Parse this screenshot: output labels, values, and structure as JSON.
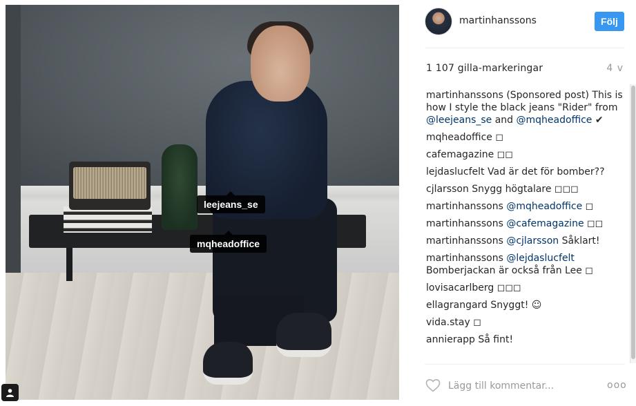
{
  "post": {
    "tags": [
      "leejeans_se",
      "mqheadoffice"
    ]
  },
  "header": {
    "username": "martinhanssons",
    "follow_label": "Följ"
  },
  "likes_text": "1 107 gilla-markeringar",
  "timestamp": "4 v",
  "comments": [
    {
      "user": "martinhanssons",
      "parts": [
        {
          "t": "text",
          "v": " (Sponsored post) This is how I style the black jeans \"Rider\" from "
        },
        {
          "t": "mention",
          "v": "@leejeans_se"
        },
        {
          "t": "text",
          "v": " and "
        },
        {
          "t": "mention",
          "v": "@mqheadoffice"
        },
        {
          "t": "text",
          "v": " ✔"
        }
      ]
    },
    {
      "user": "mqheadoffice",
      "parts": [
        {
          "t": "text",
          "v": " ◻"
        }
      ]
    },
    {
      "user": "cafemagazine",
      "parts": [
        {
          "t": "text",
          "v": " ◻◻"
        }
      ]
    },
    {
      "user": "lejdaslucfelt",
      "parts": [
        {
          "t": "text",
          "v": " Vad är det för bomber??"
        }
      ]
    },
    {
      "user": "cjlarsson",
      "parts": [
        {
          "t": "text",
          "v": " Snygg högtalare ◻◻◻"
        }
      ]
    },
    {
      "user": "martinhanssons",
      "parts": [
        {
          "t": "mention",
          "v": " @mqheadoffice"
        },
        {
          "t": "text",
          "v": " ◻"
        }
      ]
    },
    {
      "user": "martinhanssons",
      "parts": [
        {
          "t": "mention",
          "v": " @cafemagazine"
        },
        {
          "t": "text",
          "v": " ◻◻"
        }
      ]
    },
    {
      "user": "martinhanssons",
      "parts": [
        {
          "t": "mention",
          "v": " @cjlarsson"
        },
        {
          "t": "text",
          "v": " Såklart!"
        }
      ]
    },
    {
      "user": "martinhanssons",
      "parts": [
        {
          "t": "mention",
          "v": " @lejdaslucfelt"
        },
        {
          "t": "text",
          "v": " Bomberjackan är också från Lee ◻"
        }
      ]
    },
    {
      "user": "lovisacarlberg",
      "parts": [
        {
          "t": "text",
          "v": " ◻◻◻"
        }
      ]
    },
    {
      "user": "ellagrangard",
      "parts": [
        {
          "t": "text",
          "v": " Snyggt! ☺"
        }
      ]
    },
    {
      "user": "vida.stay",
      "parts": [
        {
          "t": "text",
          "v": " ◻"
        }
      ]
    },
    {
      "user": "annierapp",
      "parts": [
        {
          "t": "text",
          "v": " Så fint!"
        }
      ]
    }
  ],
  "comment_box": {
    "placeholder": "Lägg till kommentar...",
    "more_label": "ooo"
  },
  "colors": {
    "follow_button": "#3897f0",
    "mention": "#003569",
    "muted": "#999999"
  }
}
